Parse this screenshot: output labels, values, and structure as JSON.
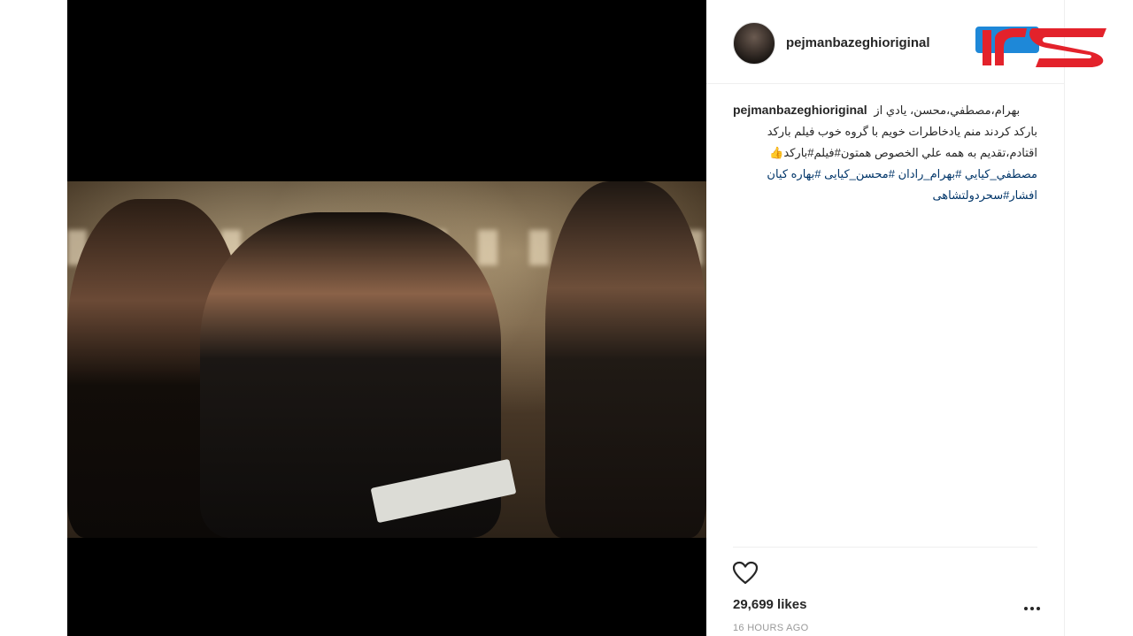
{
  "post": {
    "username": "pejmanbazeghioriginal",
    "caption_user": "pejmanbazeghioriginal",
    "caption_lines": [
      "بهرام،مصطفي،محسن، يادي از",
      "بارکد کردند منم یادخاطرات خویم با گروه خوب فیلم بارکد",
      "اقتادم،تقديم به همه علي الخصوص همتون#فیلم#بارکد👍",
      "مصطفي_کيايي #بهرام_رادان #محسن_کیایی #بهاره کیان",
      "افشار#سحردولتشاهی"
    ],
    "likes_text": "29,699 likes",
    "timestamp": "16 HOURS AGO"
  },
  "icons": {
    "like": "heart-icon",
    "more": "more-options-icon",
    "logo": "rokna-logo"
  },
  "colors": {
    "hashtag": "#003569",
    "logo_red": "#e3222b",
    "logo_blue": "#1e88d8",
    "media_bg": "#000000"
  }
}
